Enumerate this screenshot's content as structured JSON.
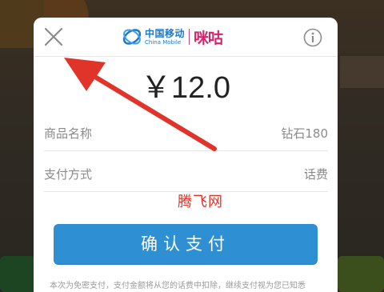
{
  "header": {
    "carrier_cn": "中国移动",
    "carrier_en": "China Mobile",
    "brand": "咪咕"
  },
  "price": "￥12.0",
  "rows": [
    {
      "label": "商品名称",
      "value": "钻石180"
    },
    {
      "label": "支付方式",
      "value": "话费"
    }
  ],
  "watermark": "腾飞网",
  "confirm_button": "确认支付",
  "notice": "本次为免密支付，支付金额将从您的话费中扣除，继续支付视为您已知悉",
  "colors": {
    "accent": "#2f8fd3",
    "brand_blue": "#1f77c8",
    "brand_pink": "#d6246f",
    "arrow": "#e0342a"
  }
}
